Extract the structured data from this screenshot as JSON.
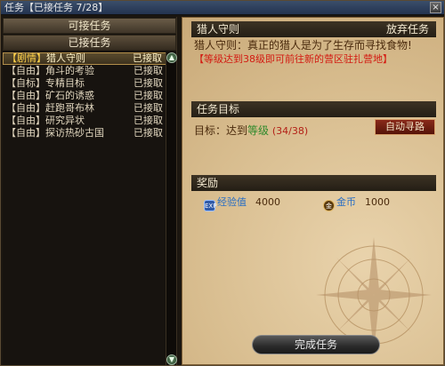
{
  "window": {
    "title": "任务【已接任务 7/28】",
    "close_label": "×"
  },
  "left_panel": {
    "tab_available": "可接任务",
    "tab_accepted": "已接任务",
    "quests": [
      {
        "type": "【剧情】",
        "name": "猎人守则",
        "status": "已接取",
        "selected": true
      },
      {
        "type": "【自由】",
        "name": "角斗的考验",
        "status": "已接取"
      },
      {
        "type": "【自标】",
        "name": "专精目标",
        "status": "已接取"
      },
      {
        "type": "【自由】",
        "name": "矿石的诱惑",
        "status": "已接取"
      },
      {
        "type": "【自由】",
        "name": "赶跑哥布林",
        "status": "已接取"
      },
      {
        "type": "【自由】",
        "name": "研究异状",
        "status": "已接取"
      },
      {
        "type": "【自由】",
        "name": "探访热砂古国",
        "status": "已接取"
      }
    ]
  },
  "detail": {
    "quest_title": "猎人守则",
    "abandon_label": "放弃任务",
    "description": "猎人守则：真正的猎人是为了生存而寻找食物!",
    "warning": "【等级达到38级即可前往新的营区驻扎营地】",
    "goal_header": "任务目标",
    "goal_prefix": "目标：达到",
    "goal_link": "等级",
    "goal_progress": "(34/38)",
    "auto_path_label": "自动寻路",
    "reward_header": "奖励",
    "rewards": [
      {
        "icon": "exp-icon",
        "icon_text": "EXP",
        "label": "经验值",
        "value": "4000"
      },
      {
        "icon": "coin-icon",
        "icon_text": "金",
        "label": "金币",
        "value": "1000"
      }
    ],
    "complete_label": "完成任务"
  }
}
